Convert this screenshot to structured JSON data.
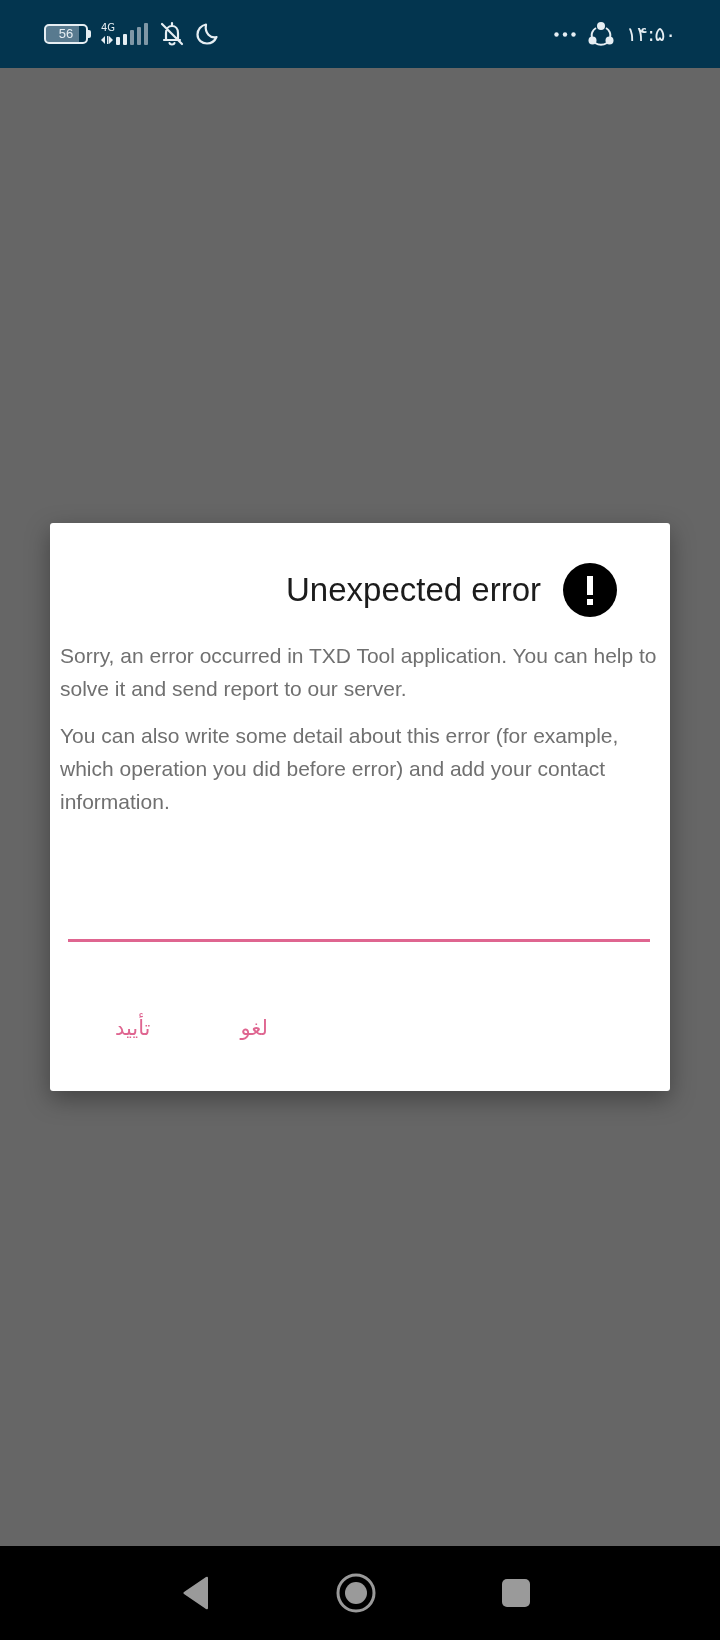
{
  "status_bar": {
    "battery": "56",
    "network": "4G",
    "time": "۱۴:۵۰"
  },
  "dialog": {
    "title": "Unexpected error",
    "paragraphs": [
      "Sorry, an error occurred in TXD Tool application. You can help to solve it and send report to our server.",
      "You can also write some detail about this error (for example, which operation you did before error) and add your contact information."
    ],
    "input": {
      "focused": true
    },
    "buttons": [
      {
        "label": "لغو"
      },
      {
        "label": "تأیید"
      }
    ]
  }
}
